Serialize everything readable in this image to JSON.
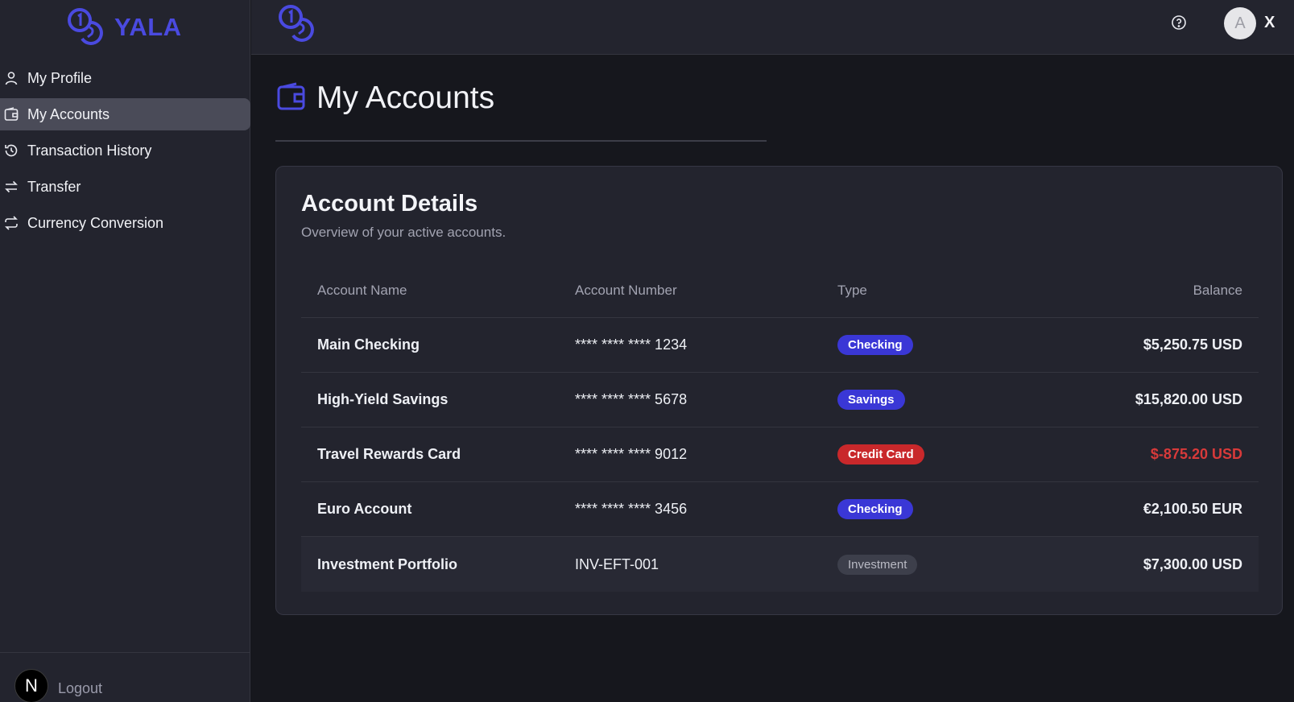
{
  "brand": {
    "name": "YALA",
    "accent": "#4a4ae0"
  },
  "sidebar": {
    "items": [
      {
        "label": "My Profile",
        "icon": "user-icon",
        "active": false
      },
      {
        "label": "My Accounts",
        "icon": "wallet-icon",
        "active": true
      },
      {
        "label": "Transaction History",
        "icon": "history-icon",
        "active": false
      },
      {
        "label": "Transfer",
        "icon": "transfer-icon",
        "active": false
      },
      {
        "label": "Currency Conversion",
        "icon": "repeat-icon",
        "active": false
      }
    ],
    "footer": {
      "avatar_letter": "N",
      "logout_label": "Logout"
    }
  },
  "topbar": {
    "help_icon": "help-circle-icon",
    "avatar_letter": "A",
    "user_initial": "X"
  },
  "page": {
    "title": "My Accounts",
    "icon": "wallet-icon"
  },
  "card": {
    "title": "Account Details",
    "subtitle": "Overview of your active accounts.",
    "columns": [
      "Account Name",
      "Account Number",
      "Type",
      "Balance"
    ],
    "rows": [
      {
        "name": "Main Checking",
        "number": "**** **** **** 1234",
        "type": "Checking",
        "balance": "$5,250.75 USD"
      },
      {
        "name": "High-Yield Savings",
        "number": "**** **** **** 5678",
        "type": "Savings",
        "balance": "$15,820.00 USD"
      },
      {
        "name": "Travel Rewards Card",
        "number": "**** **** **** 9012",
        "type": "Credit Card",
        "balance": "$-875.20 USD"
      },
      {
        "name": "Euro Account",
        "number": "**** **** **** 3456",
        "type": "Checking",
        "balance": "€2,100.50 EUR"
      },
      {
        "name": "Investment Portfolio",
        "number": "INV-EFT-001",
        "type": "Investment",
        "balance": "$7,300.00 USD"
      }
    ]
  },
  "colors": {
    "badge_checking": "#3a37d6",
    "badge_credit": "#c9282b",
    "badge_investment": "#3d3f4b",
    "negative_balance": "#d83a3a"
  }
}
